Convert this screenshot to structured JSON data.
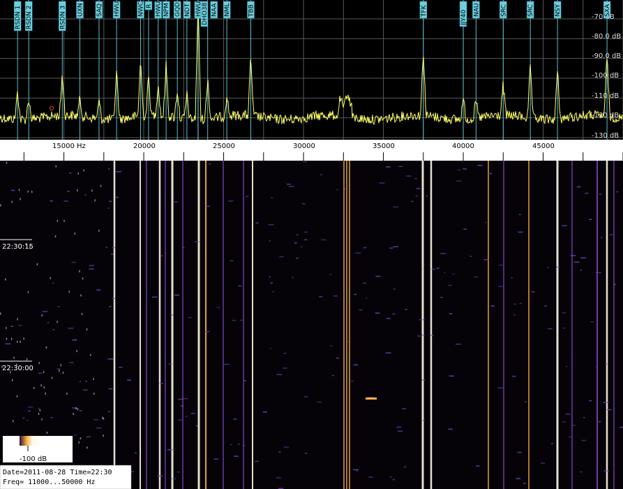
{
  "display": {
    "freq_min_hz": 11000,
    "freq_max_hz": 50000,
    "db_levels": [
      -70,
      -80,
      -90,
      -100,
      -110,
      -120,
      -130
    ],
    "colors": {
      "background": "#000000",
      "grid": "#5a5a5a",
      "trace": "#ffff66",
      "marker": "#5fd6e6",
      "label_box": "#6ccfe0",
      "waterfall_hot": "#fff8e8",
      "waterfall_mid": "#ffb040",
      "waterfall_cool": "#7a3fb8"
    }
  },
  "stations": [
    {
      "name": "RSDN 1",
      "freq_hz": 12100
    },
    {
      "name": "RSDN 2",
      "freq_hz": 12800
    },
    {
      "name": "RSDN 3",
      "freq_hz": 14900
    },
    {
      "name": "UXN",
      "freq_hz": 16000
    },
    {
      "name": "SAQ",
      "freq_hz": 17200
    },
    {
      "name": "HWU",
      "freq_hz": 18300
    },
    {
      "name": "NWC",
      "freq_hz": 19800
    },
    {
      "name": "R",
      "freq_hz": 20300
    },
    {
      "name": "HWU",
      "freq_hz": 20900
    },
    {
      "name": "NPM",
      "freq_hz": 21400
    },
    {
      "name": "GQD",
      "freq_hz": 22100
    },
    {
      "name": "NDT",
      "freq_hz": 22700
    },
    {
      "name": "HWU",
      "freq_hz": 23400
    },
    {
      "name": "DHO38",
      "freq_hz": 23400
    },
    {
      "name": "NAA",
      "freq_hz": 24000
    },
    {
      "name": "NML",
      "freq_hz": 25200
    },
    {
      "name": "TBB",
      "freq_hz": 26700
    },
    {
      "name": "TFK",
      "freq_hz": 37500
    },
    {
      "name": "JJY40",
      "freq_hz": 40000
    },
    {
      "name": "NAU",
      "freq_hz": 40800
    },
    {
      "name": "SRC",
      "freq_hz": 42500
    },
    {
      "name": "SRC",
      "freq_hz": 44200
    },
    {
      "name": "NSY",
      "freq_hz": 45900
    },
    {
      "name": "SXA",
      "freq_hz": 49000
    }
  ],
  "labels": {
    "db_unit": "dB",
    "db_ticks": [
      "-70 dB",
      "-80.0 dB",
      "-90.0 dB",
      "-100 dB",
      "-110 dB",
      "-120 dB",
      "-130 dB"
    ],
    "freq_ticks": [
      "15000 Hz",
      "20000",
      "25000",
      "30000",
      "35000",
      "40000",
      "45000"
    ],
    "time_marks": [
      "22:30:15",
      "22:30:00"
    ],
    "legend_db": "-100 dB",
    "info_date": "Date=2011-08-28 Time=22:30",
    "info_freq": "Freq= 11000...50000 Hz"
  }
}
